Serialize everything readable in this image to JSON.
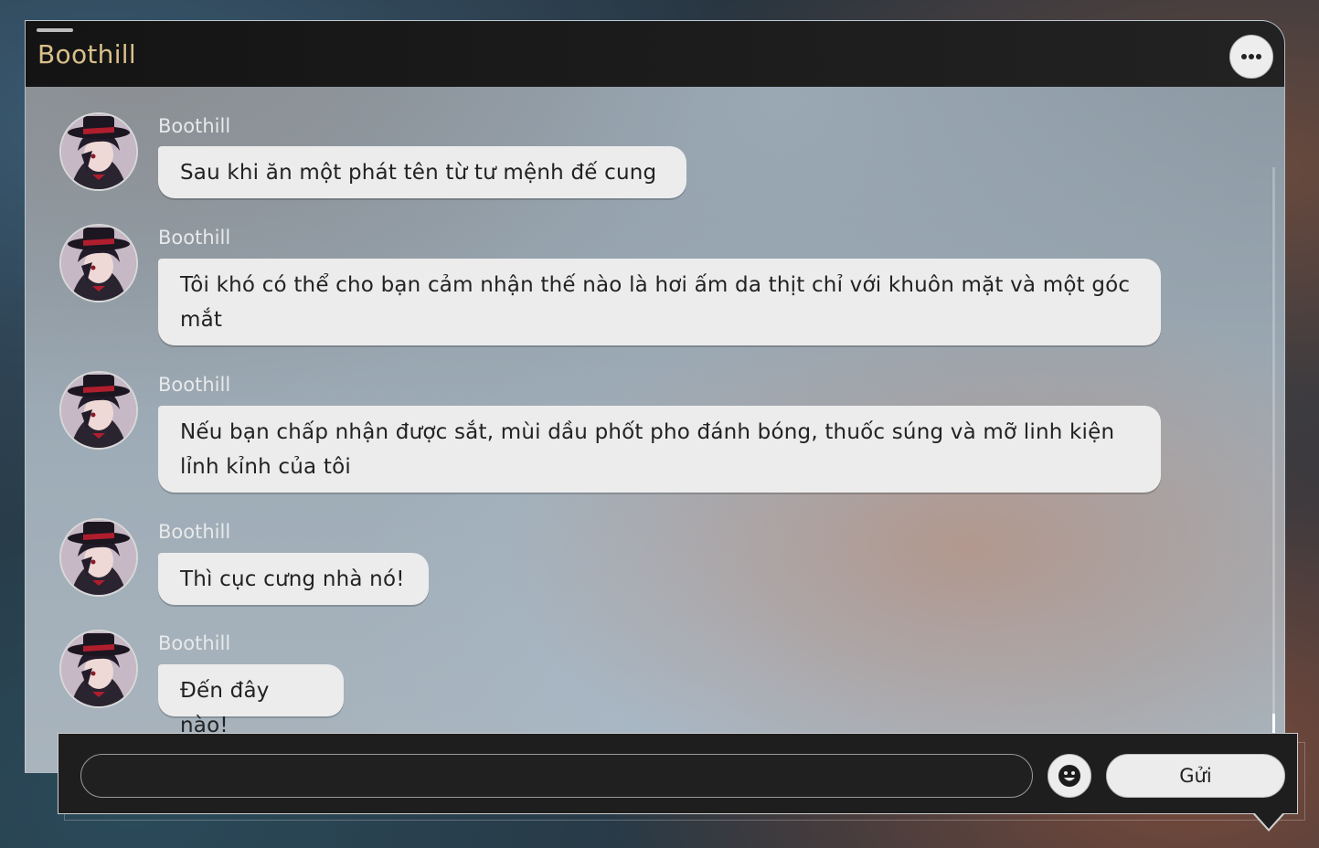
{
  "header": {
    "title": "Boothill",
    "more_icon": "more-horizontal-icon"
  },
  "messages": [
    {
      "sender": "Boothill",
      "text": "Sau khi ăn một phát tên từ tư mệnh đế cung"
    },
    {
      "sender": "Boothill",
      "text": "Tôi khó có thể cho bạn cảm nhận thế nào là hơi ấm da thịt chỉ với khuôn mặt và một góc mắt"
    },
    {
      "sender": "Boothill",
      "text": "Nếu bạn chấp nhận được sắt, mùi dầu phốt pho đánh bóng, thuốc súng và mỡ linh kiện lỉnh kỉnh của tôi"
    },
    {
      "sender": "Boothill",
      "text": "Thì cục cưng nhà nó!"
    },
    {
      "sender": "Boothill",
      "text": "Đến đây nào!"
    }
  ],
  "composer": {
    "input_value": "",
    "input_placeholder": "",
    "emoji_icon": "smiley-icon",
    "send_label": "Gửi"
  },
  "colors": {
    "title": "#d9c08a",
    "bubble": "#ececec",
    "header": "#1a1a1a"
  }
}
